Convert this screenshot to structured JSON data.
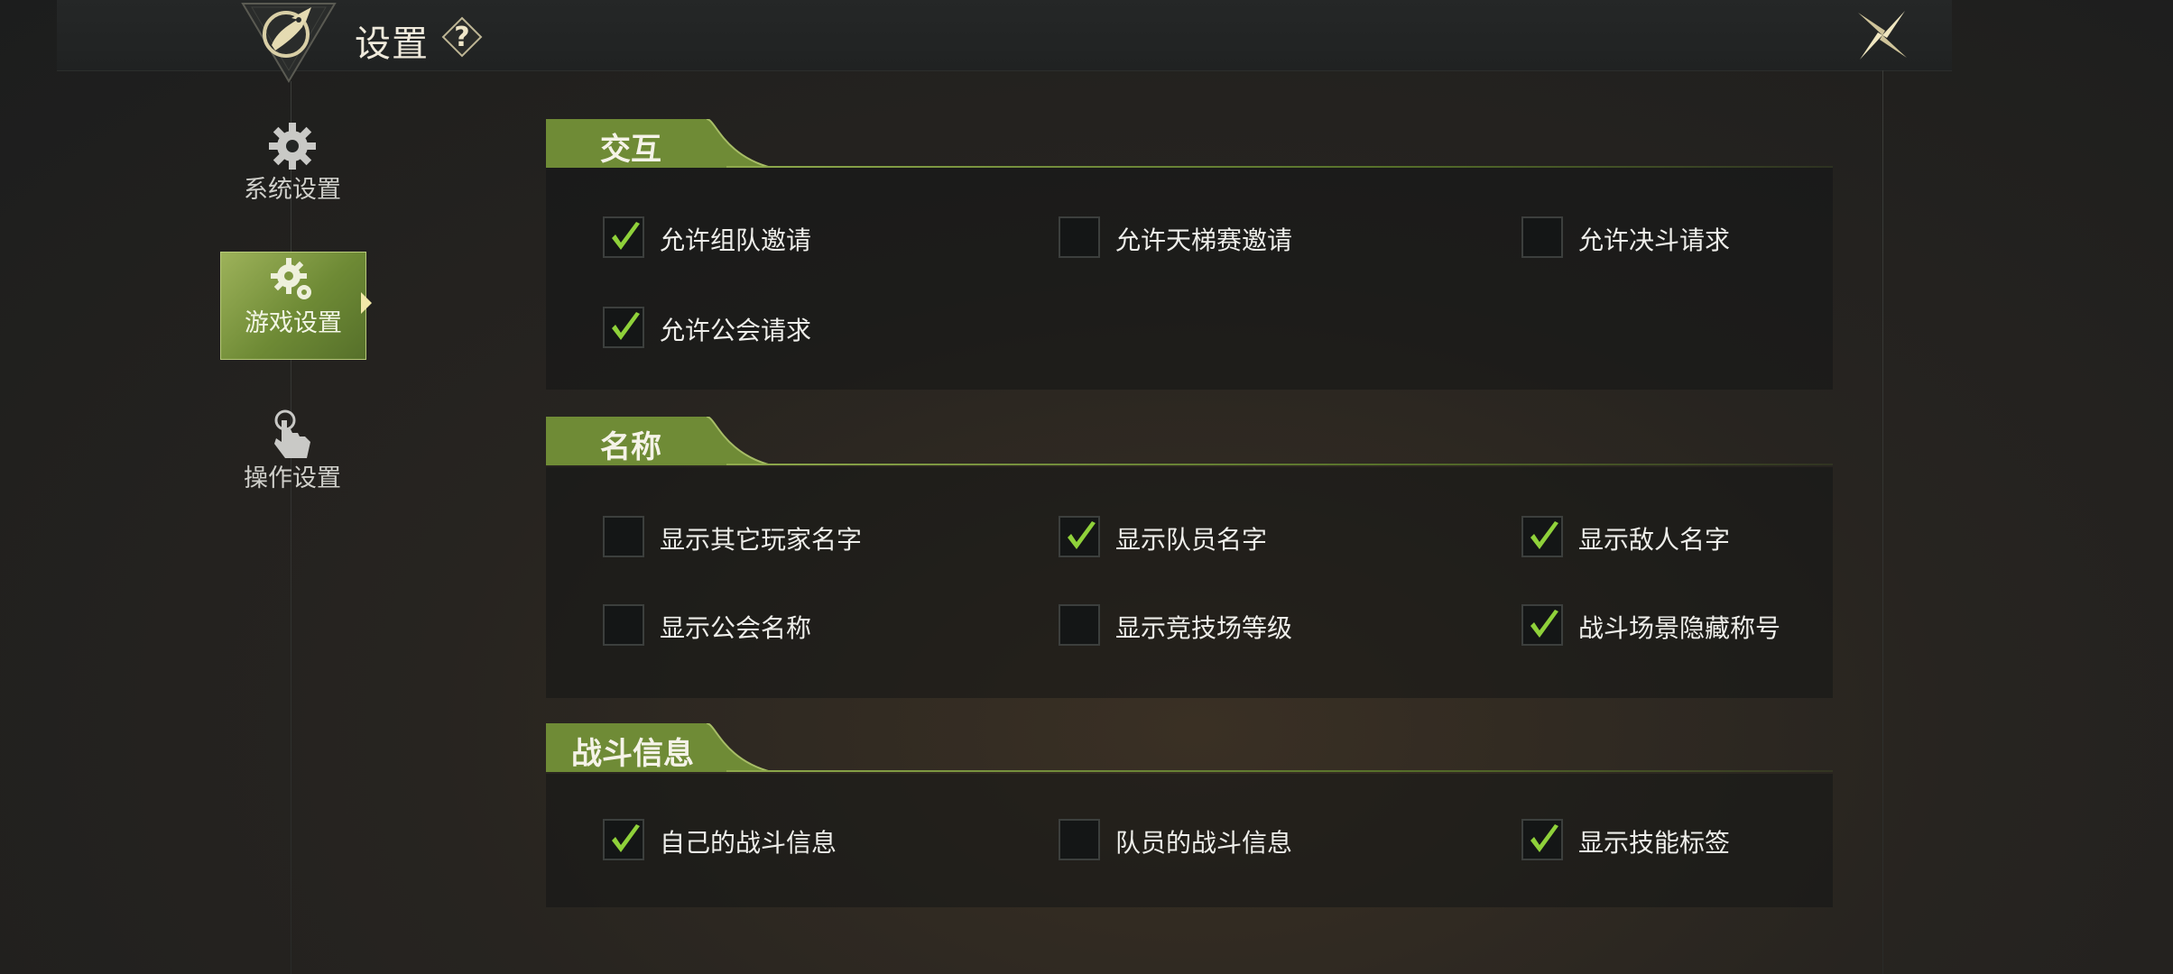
{
  "header": {
    "title": "设置",
    "help_label": "?"
  },
  "sidebar": {
    "items": [
      {
        "label": "系统设置",
        "icon": "gear-icon",
        "active": false
      },
      {
        "label": "游戏设置",
        "icon": "gears-icon",
        "active": true
      },
      {
        "label": "操作设置",
        "icon": "touch-hand-icon",
        "active": false
      }
    ]
  },
  "colors": {
    "accent": "#7f9a3e",
    "check": "#8fd13a"
  },
  "sections": [
    {
      "title": "交互",
      "options": [
        {
          "label": "允许组队邀请",
          "checked": true
        },
        {
          "label": "允许天梯赛邀请",
          "checked": false
        },
        {
          "label": "允许决斗请求",
          "checked": false
        },
        {
          "label": "允许公会请求",
          "checked": true
        }
      ]
    },
    {
      "title": "名称",
      "options": [
        {
          "label": "显示其它玩家名字",
          "checked": false
        },
        {
          "label": "显示队员名字",
          "checked": true
        },
        {
          "label": "显示敌人名字",
          "checked": true
        },
        {
          "label": "显示公会名称",
          "checked": false
        },
        {
          "label": "显示竞技场等级",
          "checked": false
        },
        {
          "label": "战斗场景隐藏称号",
          "checked": true
        }
      ]
    },
    {
      "title": "战斗信息",
      "options": [
        {
          "label": "自己的战斗信息",
          "checked": true
        },
        {
          "label": "队员的战斗信息",
          "checked": false
        },
        {
          "label": "显示技能标签",
          "checked": true
        }
      ]
    }
  ]
}
